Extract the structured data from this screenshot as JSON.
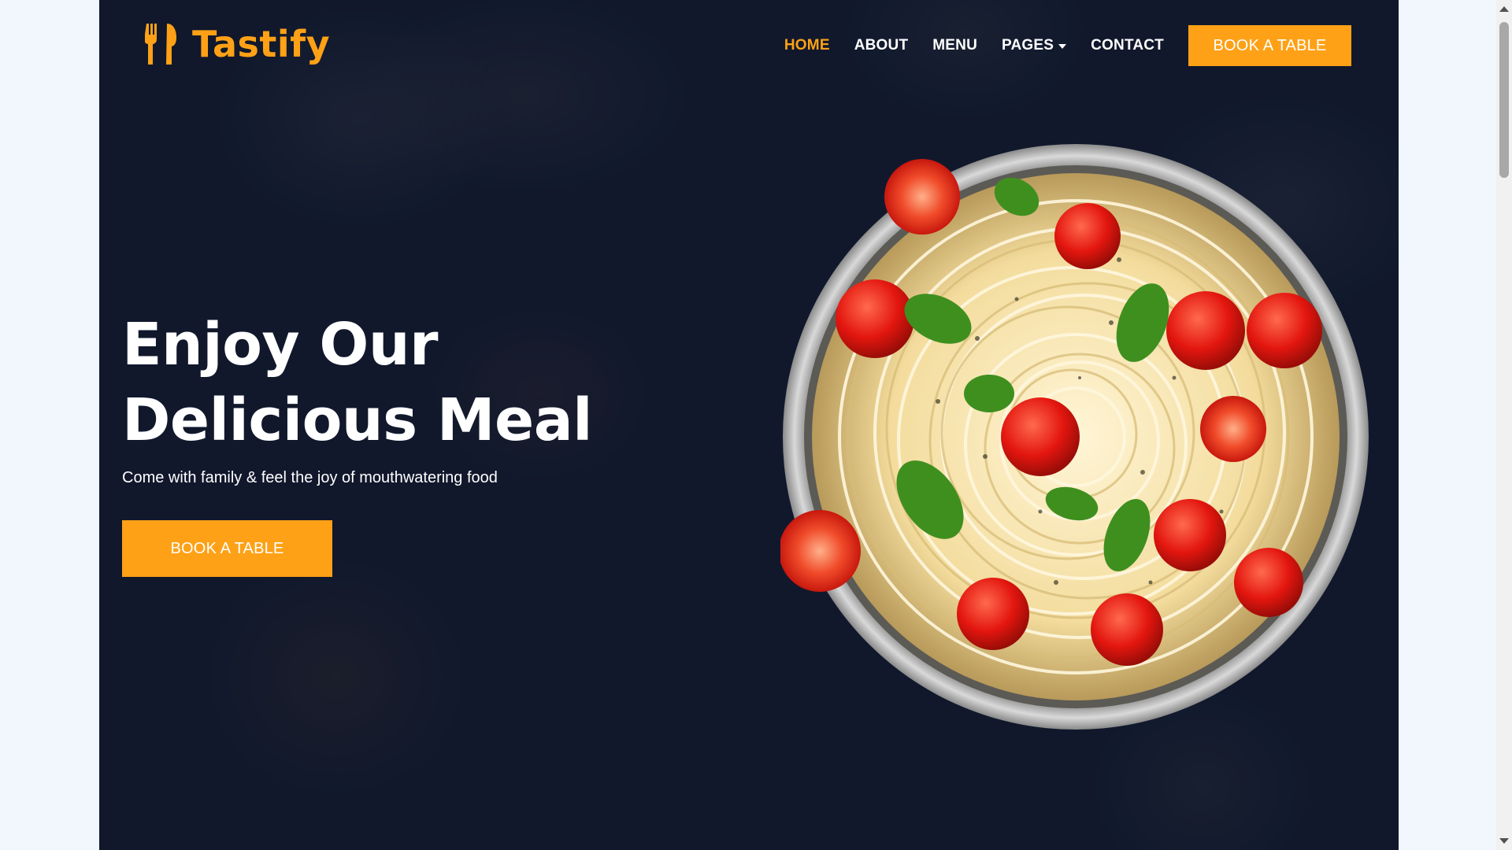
{
  "brand": {
    "name": "Tastify",
    "icon": "utensils-icon",
    "color": "#fea116"
  },
  "nav": {
    "items": [
      {
        "label": "HOME",
        "active": true
      },
      {
        "label": "ABOUT",
        "active": false
      },
      {
        "label": "MENU",
        "active": false
      },
      {
        "label": "PAGES",
        "active": false,
        "dropdown": true
      },
      {
        "label": "CONTACT",
        "active": false
      }
    ],
    "cta_label": "BOOK A TABLE"
  },
  "hero": {
    "title_line1": "Enjoy Our",
    "title_line2": "Delicious Meal",
    "subtitle": "Come with family & feel the joy of mouthwatering food",
    "cta_label": "BOOK A TABLE",
    "image": "spaghetti-bowl-image"
  },
  "colors": {
    "accent": "#fea116",
    "hero_bg": "#0f172b",
    "page_bg": "#f1f7fd",
    "text": "#ffffff"
  }
}
